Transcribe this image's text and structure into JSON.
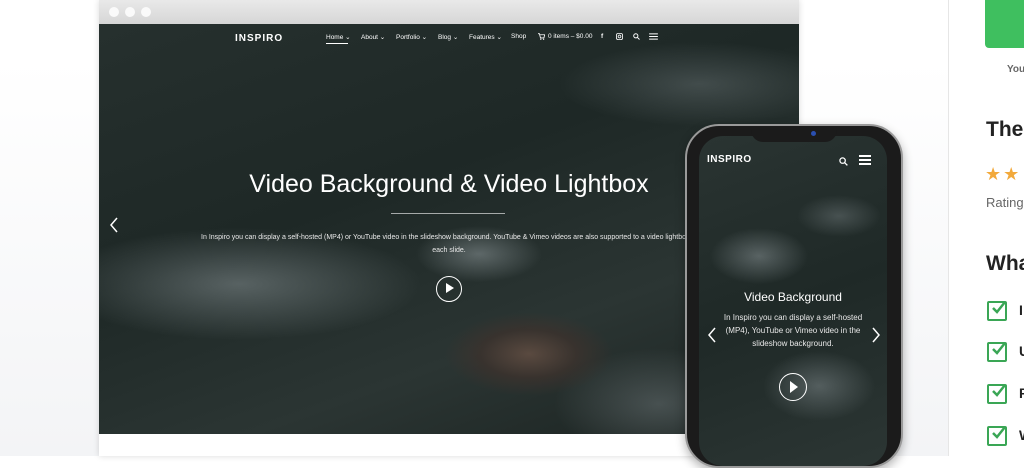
{
  "desktop": {
    "logo": "INSPIRO",
    "nav": {
      "home": "Home ⌄",
      "about": "About ⌄",
      "portfolio": "Portfolio ⌄",
      "blog": "Blog ⌄",
      "features": "Features ⌄",
      "shop": "Shop",
      "cart": "0 items – $0.00"
    },
    "hero_title": "Video Background & Video Lightbox",
    "hero_desc": "In Inspiro you can display a self-hosted (MP4) or YouTube video in the slideshow background. YouTube & Vimeo videos are also supported to a video lightbox in each slide."
  },
  "phone": {
    "logo": "INSPIRO",
    "title": "Video Background",
    "desc": "In Inspiro you can display a self-hosted (MP4), YouTube or Vimeo video in the slideshow background."
  },
  "sidebar": {
    "you_text": "You",
    "heading1": "The",
    "stars": "★★",
    "rating_text": "Rating",
    "heading2": "Wha",
    "features": [
      "I",
      "U",
      "F",
      "W"
    ]
  },
  "colors": {
    "accent_green": "#3fbf5f",
    "star_color": "#f2a93b"
  }
}
